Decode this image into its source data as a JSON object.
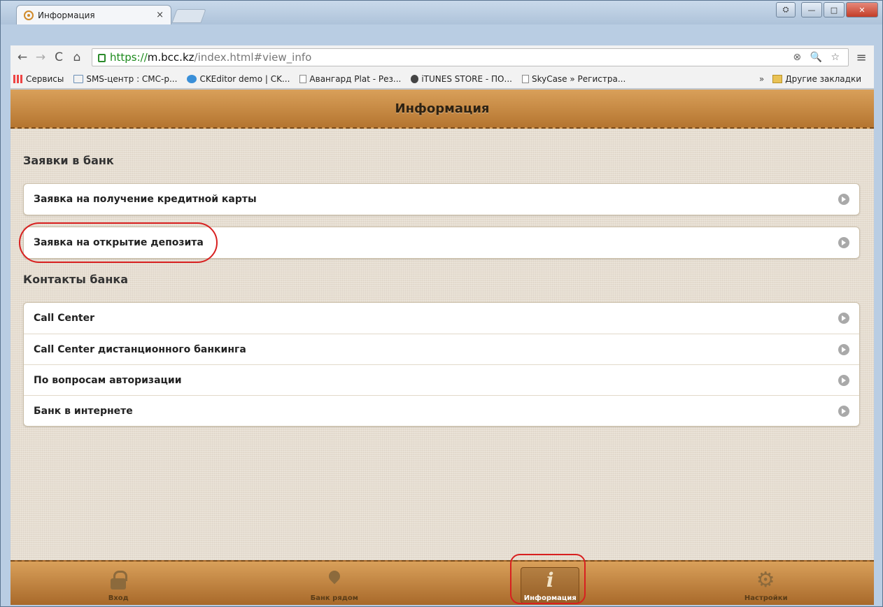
{
  "browser": {
    "tab_title": "Информация",
    "tab_close": "×",
    "url_scheme": "https://",
    "url_host": "m.bcc.kz",
    "url_path": "/index.html#view_info",
    "omnibox_icons": "⊗ 🔍 ☆",
    "menu_icon": "≡",
    "window_buttons": {
      "minimize": "—",
      "maximize": "□",
      "close": "✕"
    }
  },
  "bookmarks": {
    "items": [
      {
        "label": "Сервисы",
        "icon": "apps-icon"
      },
      {
        "label": "SMS-центр : СМС-р...",
        "icon": "mail-icon"
      },
      {
        "label": "CKEditor demo | CK...",
        "icon": "ckeditor-icon"
      },
      {
        "label": "Авангард Plat - Рез...",
        "icon": "page-icon"
      },
      {
        "label": "iTUNES STORE - ПО...",
        "icon": "apple-icon"
      },
      {
        "label": "SkyCase » Регистра...",
        "icon": "page-icon"
      }
    ],
    "overflow": "»",
    "other": "Другие закладки"
  },
  "app": {
    "header_title": "Информация",
    "sections": [
      {
        "title": "Заявки в банк",
        "items": [
          "Заявка на получение кредитной карты"
        ]
      },
      {
        "items": [
          "Заявка на открытие депозита"
        ]
      },
      {
        "title": "Контакты банка",
        "items": [
          "Call Center",
          "Call Center дистанционного банкинга",
          "По вопросам авторизации",
          "Банк в интернете"
        ]
      }
    ],
    "footer": [
      {
        "label": "Вход",
        "icon": "lock-icon"
      },
      {
        "label": "Банк рядом",
        "icon": "map-pin-icon"
      },
      {
        "label": "Информация",
        "icon": "info-icon",
        "active": true
      },
      {
        "label": "Настройки",
        "icon": "gear-icon"
      }
    ]
  },
  "colors": {
    "header": "#c88c44",
    "background": "#e6ddd0",
    "highlight": "#d82020"
  }
}
